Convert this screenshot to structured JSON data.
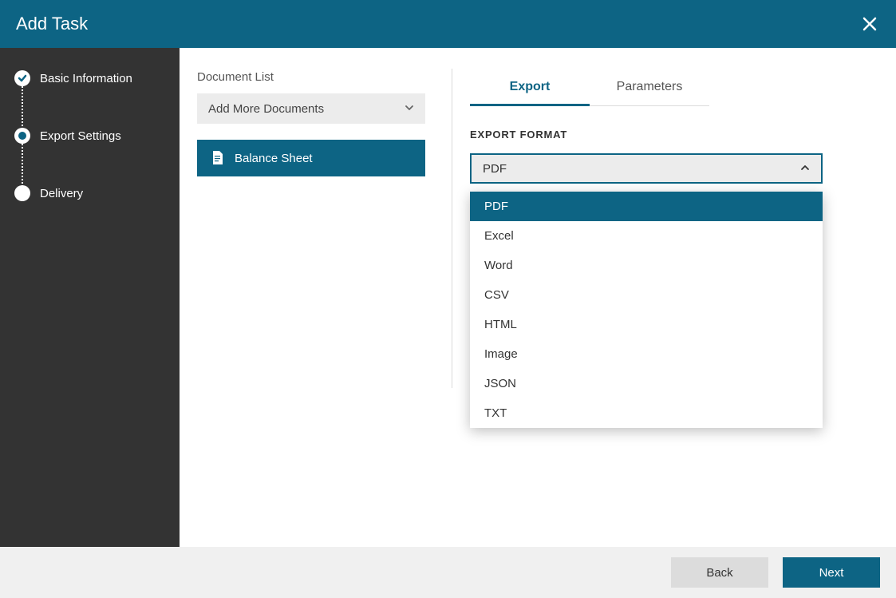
{
  "header": {
    "title": "Add Task"
  },
  "sidebar": {
    "steps": [
      {
        "label": "Basic Information"
      },
      {
        "label": "Export Settings"
      },
      {
        "label": "Delivery"
      }
    ]
  },
  "documents": {
    "section_label": "Document List",
    "add_more_label": "Add More Documents",
    "items": [
      {
        "label": "Balance Sheet"
      }
    ]
  },
  "tabs": {
    "export": "Export",
    "parameters": "Parameters"
  },
  "export": {
    "format_label": "EXPORT FORMAT",
    "selected": "PDF",
    "options": [
      "PDF",
      "Excel",
      "Word",
      "CSV",
      "HTML",
      "Image",
      "JSON",
      "TXT"
    ]
  },
  "footer": {
    "back": "Back",
    "next": "Next"
  }
}
